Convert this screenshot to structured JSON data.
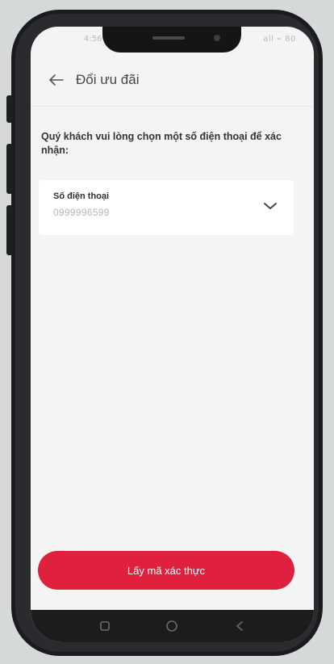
{
  "status_bar": {
    "time": "4:56",
    "indicators": "all ⌁ 80"
  },
  "header": {
    "title": "Đổi ưu đãi",
    "back_icon": "arrow-left-icon"
  },
  "instruction": "Quý khách vui lòng chọn một số điện thoại để xác nhận:",
  "phone_select": {
    "label": "Số điện thoại",
    "value": "0999996599",
    "icon": "chevron-down-icon"
  },
  "cta": {
    "label": "Lấy mã xác thực",
    "color": "#e0213d"
  },
  "nav_bar": {
    "icons": [
      "recent-apps-icon",
      "home-icon",
      "back-icon"
    ]
  }
}
